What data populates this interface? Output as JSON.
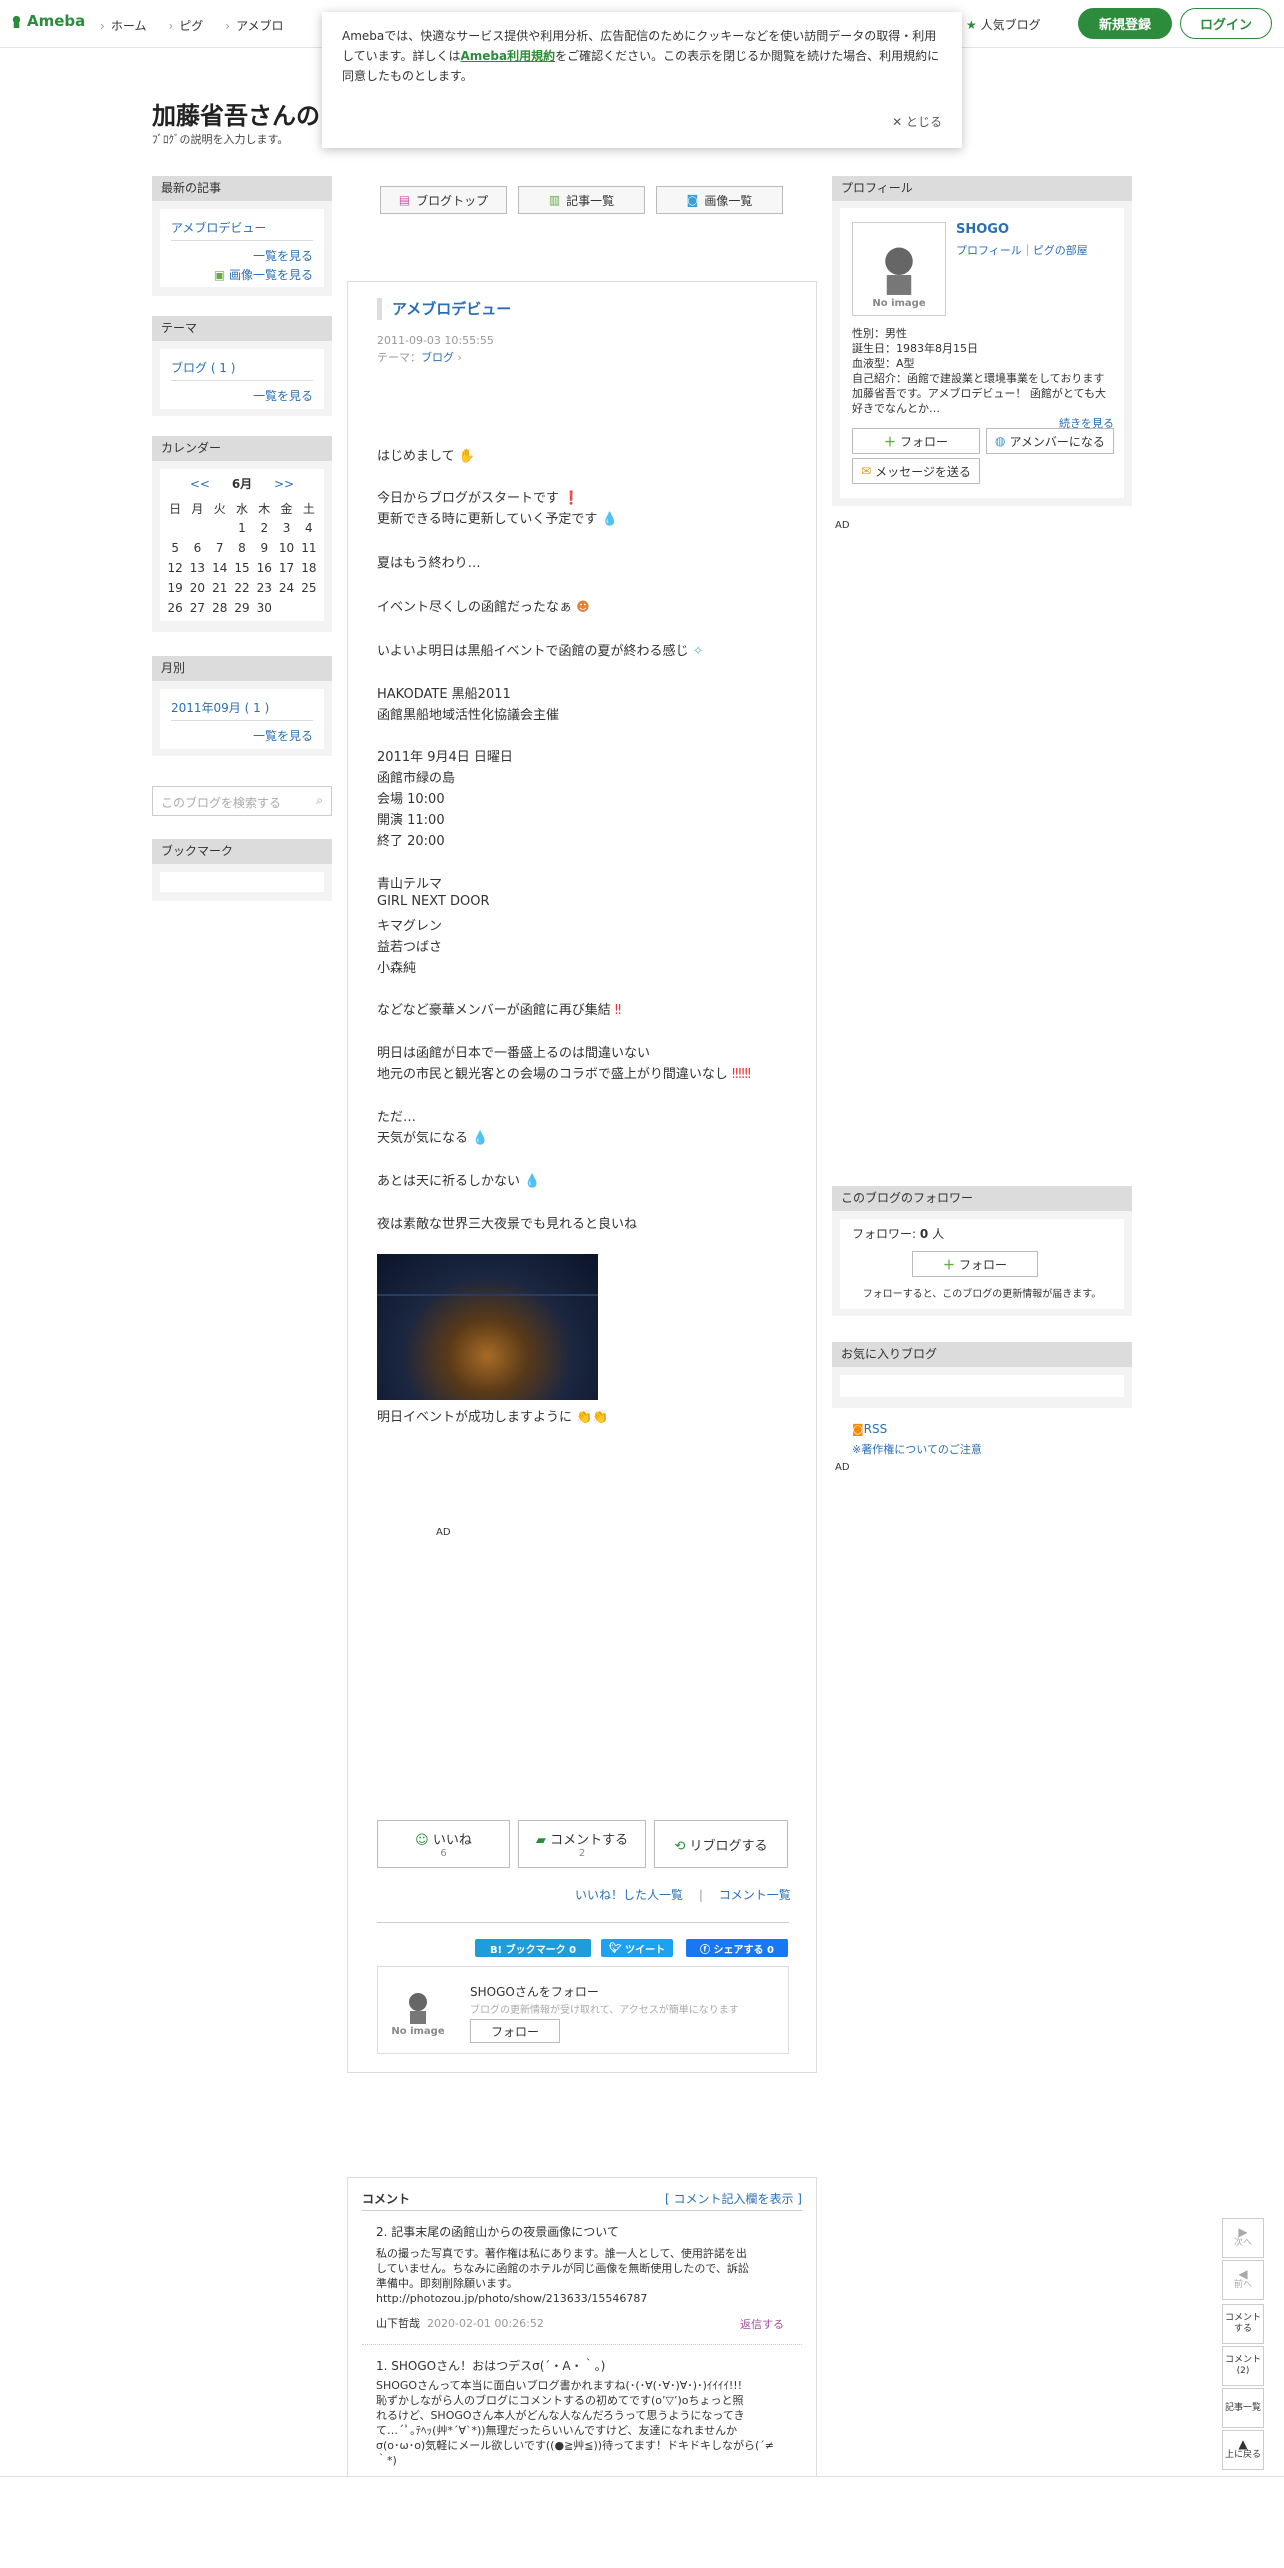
{
  "header": {
    "logo": "Ameba",
    "nav": [
      "ホーム",
      "ピグ",
      "アメブロ"
    ],
    "popular": "人気ブログ",
    "register": "新規登録",
    "login": "ログイン"
  },
  "cookie": {
    "text1": "Amebaでは、快適なサービス提供や利用分析、広告配信のためにクッキーなどを使い訪問データの取得・利用しています。詳しくは",
    "link": "Ameba利用規約",
    "text2": "をご確認ください。この表示を閉じるか閲覧を続けた場合、利用規約に同意したものとします。",
    "close": "とじる"
  },
  "blog": {
    "title": "加藤省吾さんの",
    "desc": "ﾌﾞﾛｸﾞの説明を入力します。"
  },
  "left": {
    "recent": {
      "head": "最新の記事",
      "item": "アメブロデビュー",
      "more": "一覧を見る",
      "images": "画像一覧を見る"
    },
    "theme": {
      "head": "テーマ",
      "item": "ブログ ( 1 )",
      "more": "一覧を見る"
    },
    "calendar": {
      "head": "カレンダー",
      "prev": "<<",
      "month": "6月",
      "next": ">>",
      "week": [
        "日",
        "月",
        "火",
        "水",
        "木",
        "金",
        "土"
      ],
      "rows": [
        [
          "",
          "",
          "",
          "",
          "1",
          "2",
          "3",
          "4"
        ],
        [
          "5",
          "6",
          "7",
          "8",
          "9",
          "10",
          "11"
        ],
        [
          "12",
          "13",
          "14",
          "15",
          "16",
          "17",
          "18"
        ],
        [
          "19",
          "20",
          "21",
          "22",
          "23",
          "24",
          "25"
        ],
        [
          "26",
          "27",
          "28",
          "29",
          "30",
          "",
          ""
        ]
      ]
    },
    "monthly": {
      "head": "月別",
      "item": "2011年09月 ( 1 )",
      "more": "一覧を見る"
    },
    "search": {
      "placeholder": "このブログを検索する"
    },
    "bookmark": {
      "head": "ブックマーク"
    }
  },
  "topnav": {
    "top": "ブログトップ",
    "list": "記事一覧",
    "images": "画像一覧"
  },
  "article": {
    "title": "アメブロデビュー",
    "date": "2011-09-03 10:55:55",
    "theme_label": "テーマ：",
    "theme": "ブログ",
    "lines": [
      "はじめまして",
      "今日からブログがスタートです",
      "更新できる時に更新していく予定です",
      "夏はもう終わり…",
      "イベント尽くしの函館だったなぁ",
      "いよいよ明日は黒船イベントで函館の夏が終わる感じ",
      "HAKODATE 黒船2011",
      "函館黒船地域活性化協議会主催",
      "2011年 9月4日 日曜日",
      "函館市緑の島",
      "会場 10:00",
      "開演 11:00",
      "終了 20:00",
      "青山テルマ",
      "GIRL NEXT DOOR",
      "キマグレン",
      "益若つばさ",
      "小森純",
      "などなど豪華メンバーが函館に再び集結",
      "明日は函館が日本で一番盛上るのは間違いない",
      "地元の市民と観光客との会場のコラボで盛上がり間違いなし",
      "ただ…",
      "天気が気になる",
      "あとは天に祈るしかない",
      "夜は素敵な世界三大夜景でも見れると良いね",
      "明日イベントが成功しますように"
    ],
    "ad": "AD",
    "like": "いいね",
    "like_count": "6",
    "comment": "コメントする",
    "comment_count": "2",
    "reblog": "リブログする",
    "liked_list": "いいね！した人一覧",
    "comment_list": "コメント一覧",
    "hatena": "B! ブックマーク  0",
    "tweet": "ツイート",
    "fb": "シェアする 0",
    "follow_title": "SHOGOさんをフォロー",
    "follow_sub": "ブログの更新情報が受け取れて、アクセスが簡単になります",
    "follow_btn": "フォロー",
    "noimage": "No image"
  },
  "profile": {
    "head": "プロフィール",
    "name": "SHOGO",
    "links": "プロフィール｜ピグの部屋",
    "gender": "性別：男性",
    "birthday": "誕生日：1983年8月15日",
    "blood": "血液型：A型",
    "intro": "自己紹介：函館で建設業と環境事業をしております加藤省吾です。アメブロデビュー！ 函館がとても大好きでなんとか…",
    "more": "続きを見る",
    "follow": "フォロー",
    "member": "アメンバーになる",
    "message": "メッセージを送る",
    "ad": "AD"
  },
  "followers": {
    "head": "このブログのフォロワー",
    "label": "フォロワー:",
    "count": "0",
    "unit": "人",
    "btn": "フォロー",
    "note": "フォローすると、このブログの更新情報が届きます。"
  },
  "favorites": {
    "head": "お気に入りブログ",
    "rss": "RSS",
    "copyright": "※著作権についてのご注意",
    "ad": "AD"
  },
  "comments": {
    "head": "コメント",
    "show": "[ コメント記入欄を表示 ]",
    "c2": {
      "title": "2. 記事末尾の函館山からの夜景画像について",
      "l1": "私の撮った写真です。著作権は私にあります。誰一人として、使用許諾を出",
      "l2": "していません。ちなみに函館のホテルが同じ画像を無断使用したので、訴訟",
      "l3": "準備中。即刻削除願います。",
      "l4": "http://photozou.jp/photo/show/213633/15546787",
      "author": "山下哲哉",
      "date": "2020-02-01 00:26:52",
      "reply": "返信する"
    },
    "c1": {
      "title": "1. SHOGOさん！おはつデスσ(´・A・｀。)",
      "l1": "SHOGOさんって本当に面白いブログ書かれますね(･(･∀(･∀･)∀･)･)ｲｲｲｲ!!!",
      "l2": "恥ずかしながら人のブログにコメントするの初めてです(o’▽’)oちょっと照",
      "l3": "れるけど、SHOGOさん本人がどんな人なんだろうって思うようになってき",
      "l4": "て…´ﾟ｡ﾃﾍｯ(艸*´∀`*))無理だったらいいんですけど、友達になれませんか",
      "l5": "σ(o･ω･o)気軽にメール欲しいです((●≧艸≦))待ってます！ドキドキしながら(´≠",
      "l6": "｀*)"
    }
  },
  "float": {
    "next": "次へ",
    "prev": "前へ",
    "comment_post": "コメントする",
    "comments": "コメント(2)",
    "entries": "記事一覧",
    "top": "上に戻る"
  }
}
